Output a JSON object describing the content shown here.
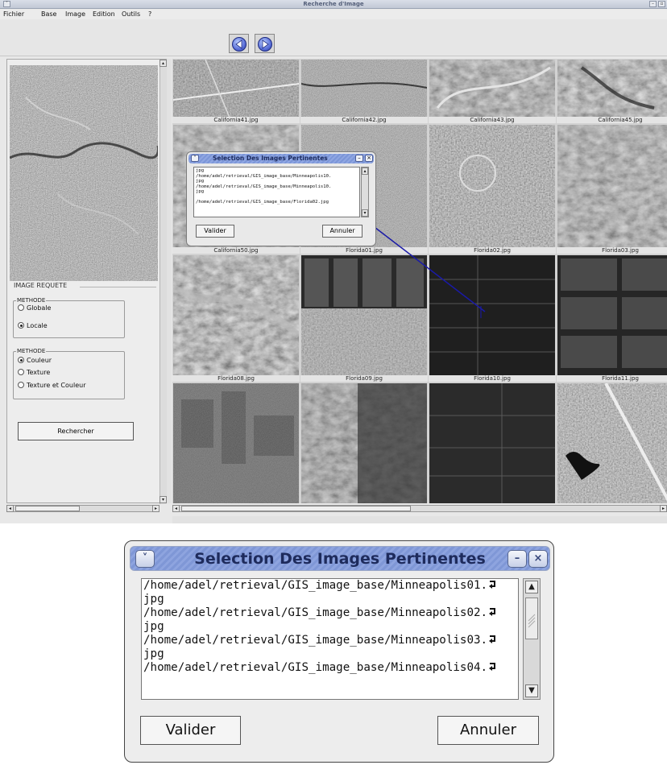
{
  "window": {
    "title": "Recherche d'Image",
    "menu": [
      "Fichier",
      "Base",
      "Image",
      "Edition",
      "Outils",
      "?"
    ]
  },
  "left_panel": {
    "section_title": "IMAGE REQUETE",
    "method_group_1": {
      "title": "METHODE",
      "options": [
        {
          "label": "Globale",
          "selected": false
        },
        {
          "label": "Locale",
          "selected": true
        }
      ]
    },
    "method_group_2": {
      "title": "METHODE",
      "options": [
        {
          "label": "Couleur",
          "selected": true
        },
        {
          "label": "Texture",
          "selected": false
        },
        {
          "label": "Texture et Couleur",
          "selected": false
        }
      ]
    },
    "search_button": "Rechercher"
  },
  "results": {
    "captions": [
      "California41.jpg",
      "California42.jpg",
      "California43.jpg",
      "California45.jpg",
      "California50.jpg",
      "Florida01.jpg",
      "Florida02.jpg",
      "Florida03.jpg",
      "Florida08.jpg",
      "Florida09.jpg",
      "Florida10.jpg",
      "Florida11.jpg"
    ]
  },
  "small_dialog": {
    "title": "Selection Des Images Pertinentes",
    "lines": [
      "jpg",
      "/home/adel/retrieval/GIS_image_base/Minneapolis10.",
      "jpg",
      "/home/adel/retrieval/GIS_image_base/Minneapolis10.",
      "jpg",
      "",
      "/home/adel/retrieval/GIS_image_base/Florida02.jpg"
    ],
    "validate_button": "Valider",
    "cancel_button": "Annuler"
  },
  "big_dialog": {
    "title": "Selection Des Images Pertinentes",
    "lines": [
      {
        "text": "/home/adel/retrieval/GIS_image_base/Minneapolis01.",
        "wrapped": true
      },
      {
        "text": "jpg",
        "wrapped": false
      },
      {
        "text": "/home/adel/retrieval/GIS_image_base/Minneapolis02.",
        "wrapped": true
      },
      {
        "text": "jpg",
        "wrapped": false
      },
      {
        "text": "/home/adel/retrieval/GIS_image_base/Minneapolis03.",
        "wrapped": true
      },
      {
        "text": "jpg",
        "wrapped": false
      },
      {
        "text": "/home/adel/retrieval/GIS_image_base/Minneapolis04.",
        "wrapped": true
      }
    ],
    "validate_button": "Valider",
    "cancel_button": "Annuler"
  },
  "colors": {
    "title_stripes": "#7f97d6",
    "connector_line": "#1a1aa8"
  },
  "icons": [
    "chevron-down-icon",
    "minimize-icon",
    "close-icon",
    "arrow-left-icon",
    "arrow-right-icon",
    "line-wrap-icon",
    "scroll-up-icon",
    "scroll-down-icon"
  ]
}
